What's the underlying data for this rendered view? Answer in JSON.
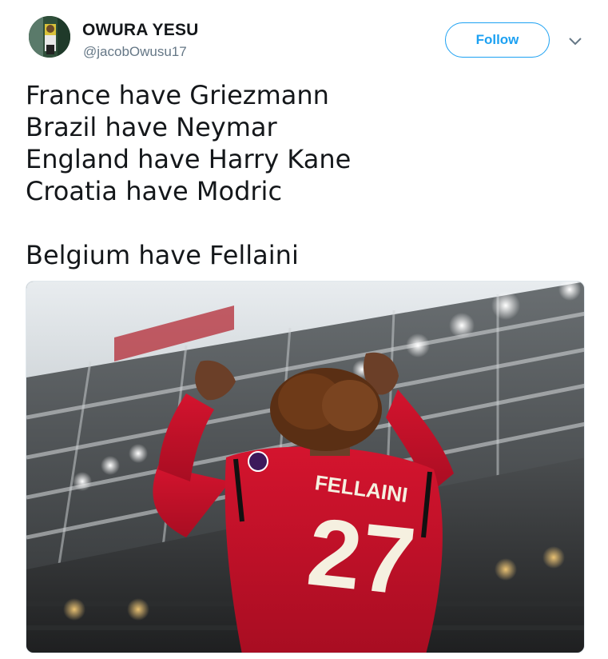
{
  "tweet": {
    "display_name": "OWURA YESU",
    "handle": "@jacobOwusu17",
    "follow_label": "Follow",
    "caret_icon": "chevron-down-icon",
    "text_lines": [
      "France have Griezmann",
      "Brazil have Neymar",
      "England have Harry Kane",
      "Croatia have Modric"
    ],
    "text_last_line": "Belgium have Fellaini",
    "media": {
      "jersey_name": "FELLAINI",
      "jersey_number": "27",
      "description_icon": "photo-stadium-player"
    }
  },
  "colors": {
    "accent": "#1da1f2",
    "text": "#14171a",
    "secondary": "#657786",
    "jersey_red": "#c8102e"
  }
}
